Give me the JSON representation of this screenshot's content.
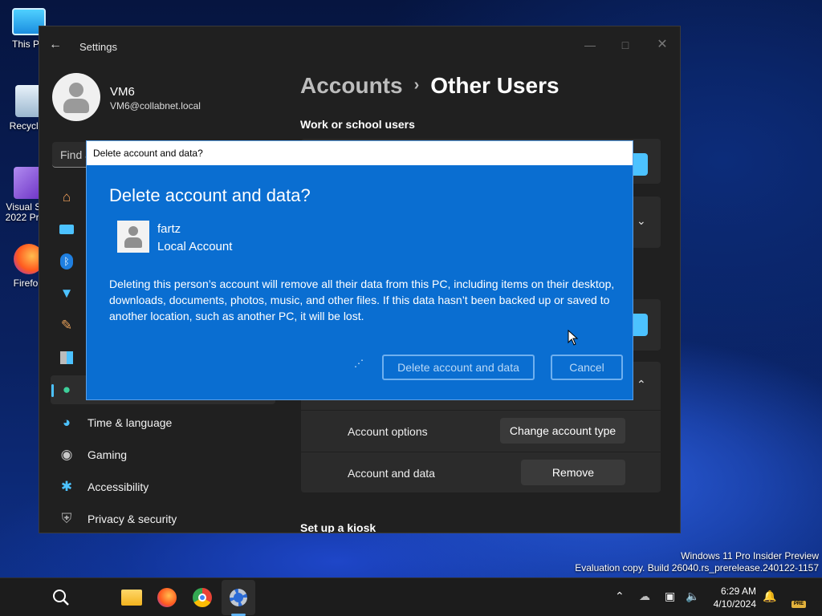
{
  "desktop": {
    "icons": [
      {
        "label": "This P",
        "icon": "monitor-icon"
      },
      {
        "label": "Recycle",
        "icon": "recycle-bin-icon"
      },
      {
        "label": "Visual St\n2022 Pre",
        "icon": "visual-studio-icon"
      },
      {
        "label": "Firefo",
        "icon": "firefox-icon"
      }
    ],
    "watermark_line1": "Windows 11 Pro Insider Preview",
    "watermark_line2": "Evaluation copy. Build 26040.rs_prerelease.240122-1157"
  },
  "window": {
    "app_title": "Settings",
    "profile": {
      "name": "VM6",
      "email": "VM6@collabnet.local"
    },
    "search_placeholder": "Find a",
    "nav": [
      {
        "label": "",
        "icon": "home-icon"
      },
      {
        "label": "",
        "icon": "system-icon"
      },
      {
        "label": "",
        "icon": "bluetooth-icon"
      },
      {
        "label": "",
        "icon": "network-icon"
      },
      {
        "label": "",
        "icon": "personalization-icon"
      },
      {
        "label": "",
        "icon": "apps-icon"
      },
      {
        "label": "",
        "icon": "accounts-icon",
        "active": true
      },
      {
        "label": "Time & language",
        "icon": "globe-clock-icon"
      },
      {
        "label": "Gaming",
        "icon": "gamepad-icon"
      },
      {
        "label": "Accessibility",
        "icon": "accessibility-icon"
      },
      {
        "label": "Privacy & security",
        "icon": "shield-icon"
      }
    ],
    "breadcrumb": {
      "parent": "Accounts",
      "separator": "›",
      "current": "Other Users"
    },
    "sections": {
      "work_school": "Work or school users",
      "kiosk": "Set up a kiosk"
    },
    "account_rows": [
      {
        "label": "Account options",
        "button": "Change account type"
      },
      {
        "label": "Account and data",
        "button": "Remove"
      }
    ]
  },
  "dialog": {
    "window_title": "Delete account and data?",
    "heading": "Delete account and data?",
    "user_name": "fartz",
    "user_type": "Local Account",
    "body": "Deleting this person’s account will remove all their data from this PC, including items on their desktop, downloads, documents, photos, music, and other files. If this data hasn’t been backed up or saved to another location, such as another PC, it will be lost.",
    "spinner": "⋰",
    "delete_button": "Delete account and data",
    "cancel_button": "Cancel"
  },
  "taskbar": {
    "time": "6:29 AM",
    "date": "4/10/2024",
    "badge": "PRE"
  },
  "colors": {
    "dialog_bg": "#0a6ed1",
    "accent": "#4cc2ff",
    "window_bg": "#202020"
  }
}
